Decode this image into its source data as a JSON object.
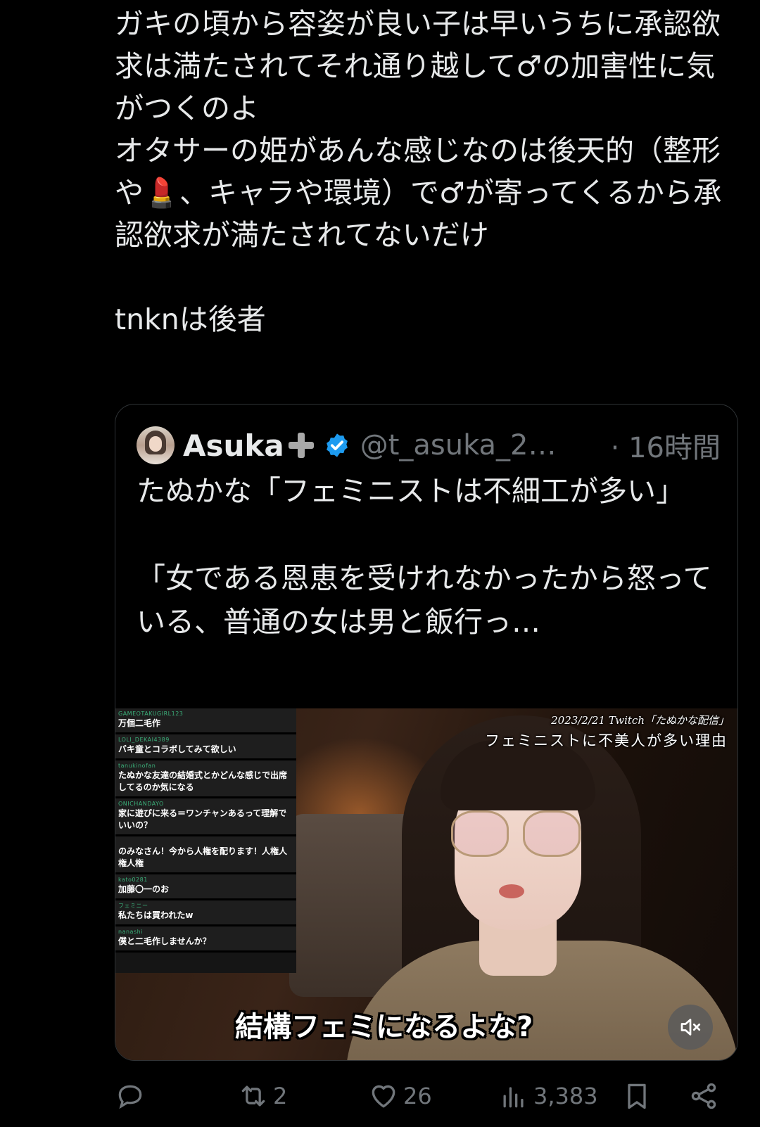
{
  "tweet": {
    "text": "ガキの頃から容姿が良い子は早いうちに承認欲求は満たされてそれ通り越して♂の加害性に気がつくのよ\nオタサーの姫があんな感じなのは後天的（整形や💄、キャラや環境）で♂が寄ってくるから承認欲求が満たされてないだけ\n\ntnknは後者"
  },
  "quote": {
    "name": "Asuka",
    "handle": "@t_asuka_2…",
    "time": "· 16時間",
    "text": "たぬかな「フェミニストは不細工が多い」\n\n「女である恩恵を受けれなかったから怒っている、普通の女は男と飯行っ…"
  },
  "media": {
    "caption_date": "2023/2/21  Twitch「たぬかな配信」",
    "caption_title": "フェミニストに不美人が多い理由",
    "subtitle": "結構フェミになるよな?",
    "mute_icon": "speaker-mute-icon",
    "chat": [
      {
        "user": "GAMEOTAKUGIRL123",
        "text": "万個二毛作"
      },
      {
        "user": "LOLI_DEKAI4389",
        "text": "バキ童とコラボしてみて欲しい"
      },
      {
        "user": "tanukinofan",
        "text": "たぬかな友達の結婚式とかどんな感じで出席してるのか気になる"
      },
      {
        "user": "ONICHANDAYO",
        "text": "家に遊びに来る＝ワンチャンあるって理解でいいの？"
      },
      {
        "user": "",
        "text": "のみなさん！今から人権を配ります！人権人権人権"
      },
      {
        "user": "kato0281",
        "text": "加藤〇一のお"
      },
      {
        "user": "フェミニー",
        "text": "私たちは買われたw"
      },
      {
        "user": "nanashi",
        "text": "僕と二毛作しませんか？"
      }
    ]
  },
  "actions": {
    "reply_count": "",
    "retweet_count": "2",
    "like_count": "26",
    "views_count": "3,383"
  },
  "colors": {
    "background": "#000000",
    "text": "#e7e9ea",
    "muted": "#71767b",
    "verified": "#1d9bf0",
    "border": "#2f3336"
  }
}
